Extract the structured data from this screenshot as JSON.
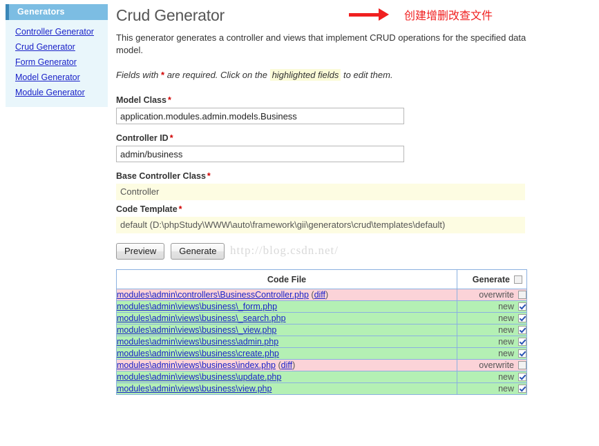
{
  "sidebar": {
    "header": "Generators",
    "items": [
      {
        "label": "Controller Generator"
      },
      {
        "label": "Crud Generator"
      },
      {
        "label": "Form Generator"
      },
      {
        "label": "Model Generator"
      },
      {
        "label": "Module Generator"
      }
    ]
  },
  "main": {
    "title": "Crud Generator",
    "annotation": "创建增删改查文件",
    "intro": "This generator generates a controller and views that implement CRUD operations for the specified data model.",
    "hint_prefix": "Fields with ",
    "hint_star": "*",
    "hint_middle": " are required. Click on the ",
    "hint_highlight": "highlighted fields",
    "hint_suffix": " to edit them.",
    "watermark": "http://blog.csdn.net/"
  },
  "form": {
    "fields": [
      {
        "label": "Model Class",
        "required": "*",
        "value": "application.modules.admin.models.Business",
        "type": "input"
      },
      {
        "label": "Controller ID",
        "required": "*",
        "value": "admin/business",
        "type": "input"
      },
      {
        "label": "Base Controller Class",
        "required": "*",
        "value": "Controller",
        "type": "sticky"
      },
      {
        "label": "Code Template",
        "required": "*",
        "value": "default (D:\\phpStudy\\WWW\\auto\\framework\\gii\\generators\\crud\\templates\\default)",
        "type": "sticky"
      }
    ],
    "preview_label": "Preview",
    "generate_label": "Generate"
  },
  "table": {
    "columns": {
      "file": "Code File",
      "generate": "Generate"
    },
    "header_checkbox_checked": false,
    "rows": [
      {
        "file": "modules\\admin\\controllers\\BusinessController.php",
        "diff": "diff",
        "status": "overwrite",
        "checked": false
      },
      {
        "file": "modules\\admin\\views\\business\\_form.php",
        "diff": "",
        "status": "new",
        "checked": true
      },
      {
        "file": "modules\\admin\\views\\business\\_search.php",
        "diff": "",
        "status": "new",
        "checked": true
      },
      {
        "file": "modules\\admin\\views\\business\\_view.php",
        "diff": "",
        "status": "new",
        "checked": true
      },
      {
        "file": "modules\\admin\\views\\business\\admin.php",
        "diff": "",
        "status": "new",
        "checked": true
      },
      {
        "file": "modules\\admin\\views\\business\\create.php",
        "diff": "",
        "status": "new",
        "checked": true
      },
      {
        "file": "modules\\admin\\views\\business\\index.php",
        "diff": "diff",
        "status": "overwrite",
        "checked": false
      },
      {
        "file": "modules\\admin\\views\\business\\update.php",
        "diff": "",
        "status": "new",
        "checked": true
      },
      {
        "file": "modules\\admin\\views\\business\\view.php",
        "diff": "",
        "status": "new",
        "checked": true
      }
    ]
  },
  "colors": {
    "link": "#1a22c8",
    "accent_blue": "#7cbde3",
    "accent_blue_dark": "#3b87b8",
    "sidebar_bg": "#e9f6fb",
    "highlight_yellow": "#fdfce2",
    "row_new": "#b4f0b4",
    "row_overwrite": "#fbd3d8",
    "annotation_red": "#f02020",
    "required_red": "#d00000",
    "table_border": "#8ab0e0"
  }
}
